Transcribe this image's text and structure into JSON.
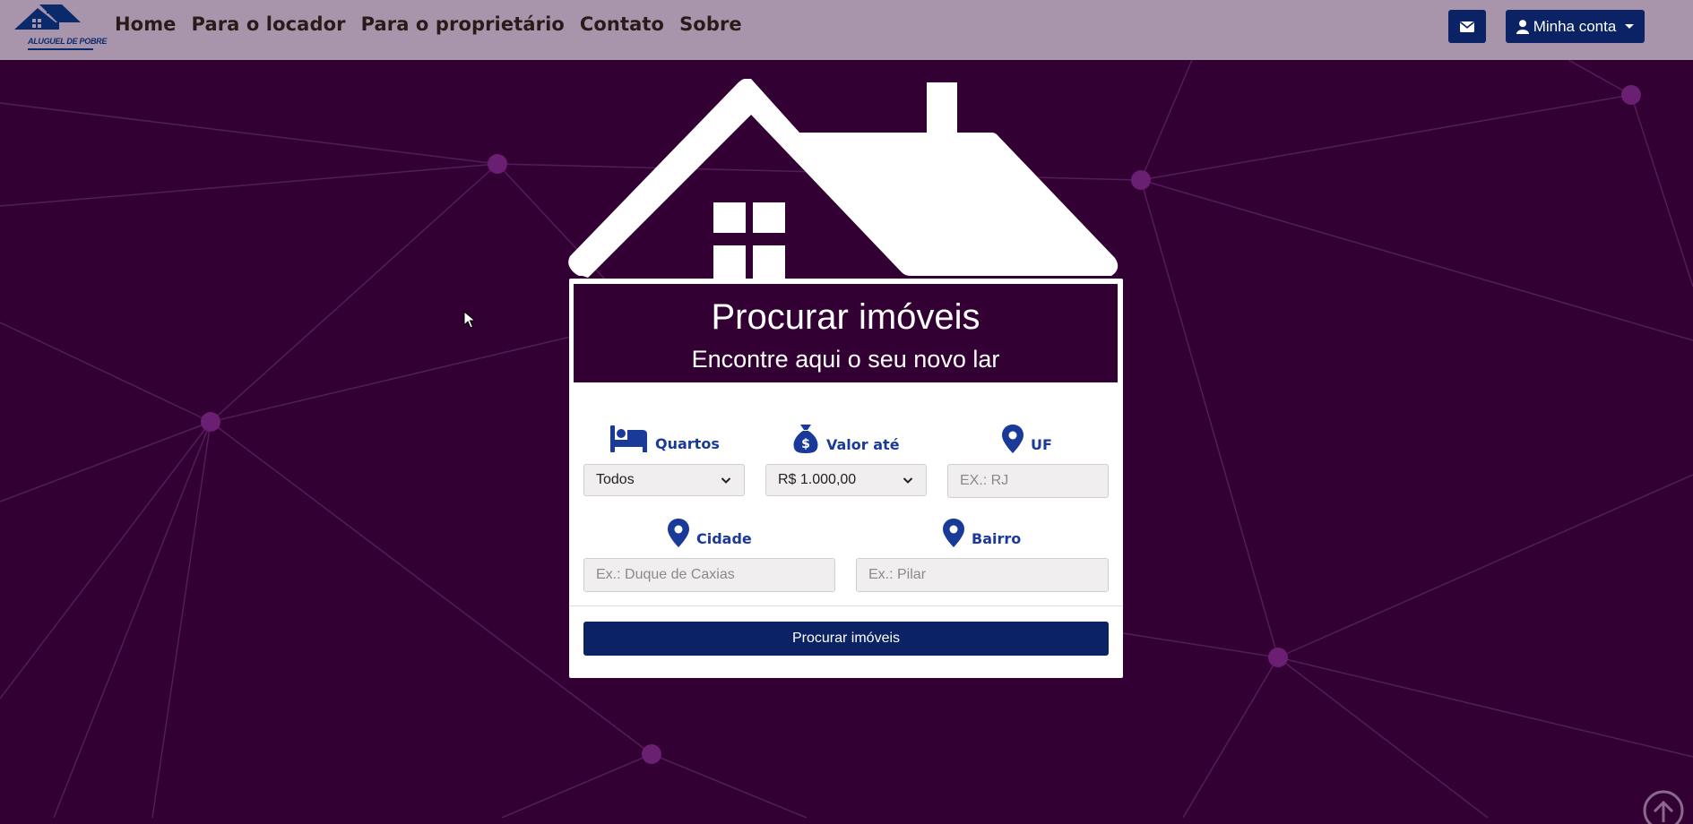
{
  "navbar": {
    "logo_text": "ALUGUEL DE POBRE",
    "links": [
      "Home",
      "Para o locador",
      "Para o proprietário",
      "Contato",
      "Sobre"
    ],
    "mail_icon": "envelope-icon",
    "account_label": "Minha conta",
    "account_icon": "user-icon"
  },
  "search_card": {
    "title": "Procurar imóveis",
    "subtitle": "Encontre aqui o seu novo lar",
    "fields": {
      "quartos": {
        "label": "Quartos",
        "icon": "bed-icon",
        "value": "Todos"
      },
      "valor": {
        "label": "Valor até",
        "icon": "money-bag-icon",
        "value": "R$ 1.000,00"
      },
      "uf": {
        "label": "UF",
        "icon": "map-pin-icon",
        "placeholder": "EX.: RJ"
      },
      "cidade": {
        "label": "Cidade",
        "icon": "map-pin-icon",
        "placeholder": "Ex.: Duque de Caxias"
      },
      "bairro": {
        "label": "Bairro",
        "icon": "map-pin-icon",
        "placeholder": "Ex.: Pilar"
      }
    },
    "submit_label": "Procurar imóveis"
  },
  "colors": {
    "background": "#330033",
    "navbar": "#a995ab",
    "primary": "#0b2264",
    "label": "#1a3a9a"
  }
}
